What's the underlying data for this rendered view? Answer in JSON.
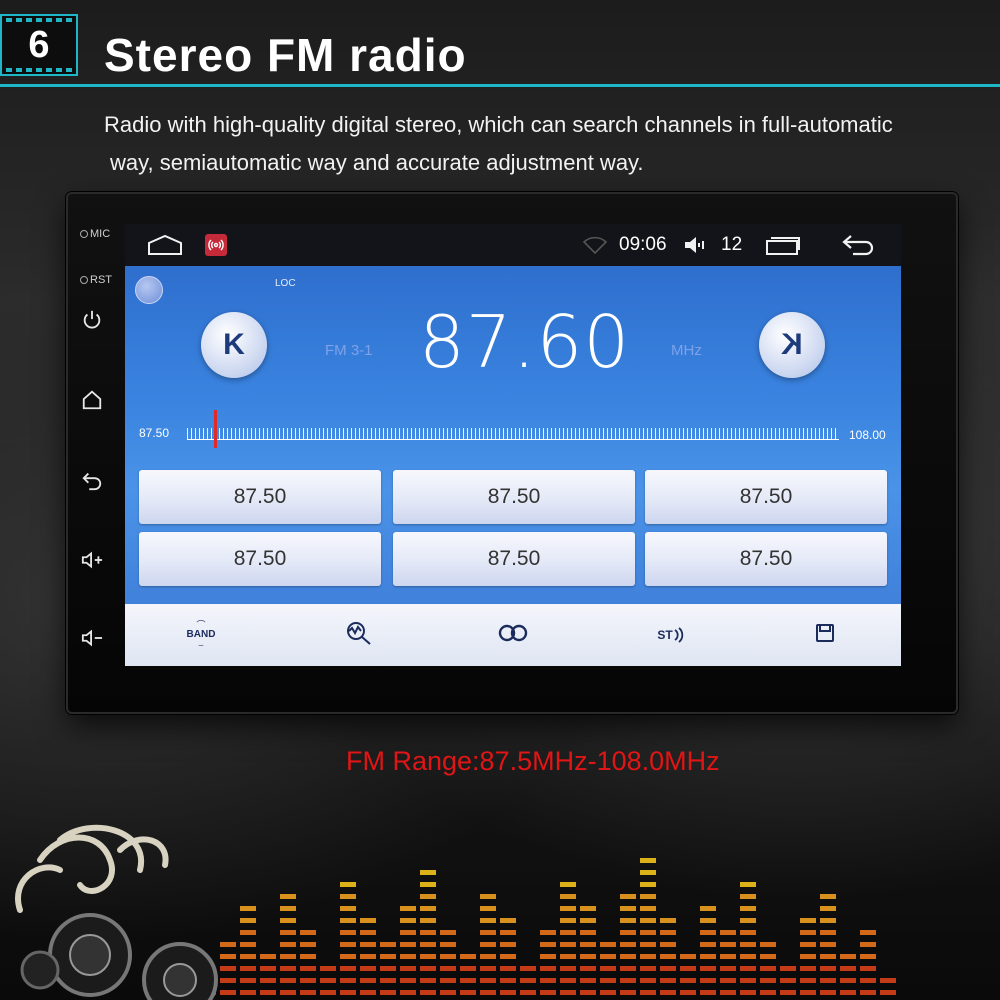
{
  "header": {
    "number": "6",
    "title": "Stereo FM radio",
    "description_line1": "Radio with high-quality digital stereo, which can search channels in full-automatic",
    "description_line2": "way, semiautomatic way and accurate adjustment way."
  },
  "device": {
    "side_labels": [
      "MIC",
      "RST"
    ],
    "side_icons": [
      "power-icon",
      "home-icon",
      "back-icon",
      "volume-up-icon",
      "volume-down-icon"
    ]
  },
  "statusbar": {
    "time": "09:06",
    "volume": "12",
    "icons": [
      "home-icon",
      "radio-app-icon",
      "wifi-icon",
      "speaker-icon",
      "recent-apps-icon",
      "back-icon"
    ]
  },
  "radio": {
    "loc_label": "LOC",
    "band": "FM 3-1",
    "frequency": "87.60",
    "unit": "MHz",
    "seek_prev_label": "K",
    "seek_next_label": "K",
    "scale_min": "87.50",
    "scale_max": "108.00",
    "tuning_position": 0.005
  },
  "presets": [
    "87.50",
    "87.50",
    "87.50",
    "87.50",
    "87.50",
    "87.50"
  ],
  "toolbar": {
    "band_label": "BAND",
    "st_label": "ST",
    "icons": [
      "band-icon",
      "search-icon",
      "loop-icon",
      "stereo-icon",
      "save-icon"
    ]
  },
  "footer": {
    "range_text": "FM Range:87.5MHz-108.0MHz"
  },
  "colors": {
    "accent": "#1fb6c8",
    "screen_blue": "#3a84e0",
    "range_red": "#e01515",
    "needle_red": "#e22929"
  }
}
